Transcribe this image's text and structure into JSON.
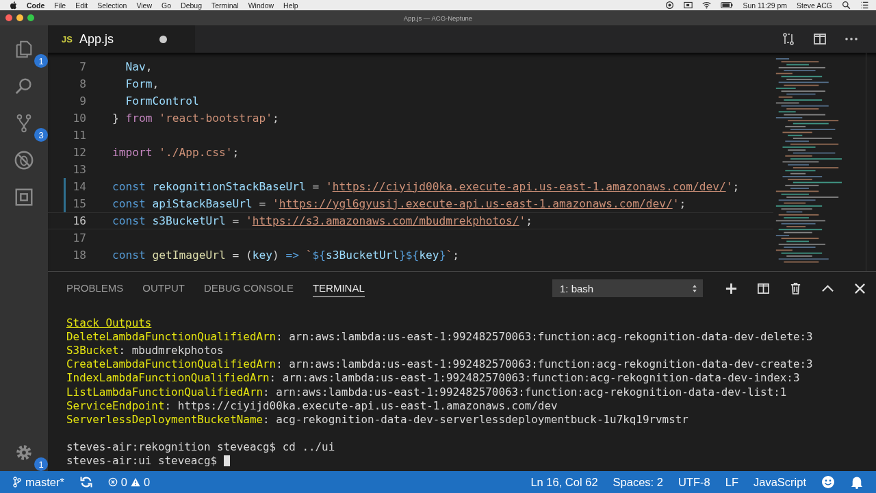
{
  "menu_bar": {
    "app": "Code",
    "items": [
      "File",
      "Edit",
      "Selection",
      "View",
      "Go",
      "Debug",
      "Terminal",
      "Window",
      "Help"
    ],
    "clock": "Sun 11:29 pm",
    "user": "Steve ACG"
  },
  "window": {
    "title": "App.js — ACG-Neptune"
  },
  "activity_bar": {
    "explorer_badge": "1",
    "git_badge": "3",
    "settings_badge": "1"
  },
  "tab": {
    "icon_text": "JS",
    "label": "App.js",
    "dirty": true
  },
  "editor": {
    "lines": [
      {
        "number": "7",
        "current": false,
        "modified": false,
        "tokens": [
          {
            "text": "  Nav",
            "kind": "var"
          },
          {
            "text": ",",
            "kind": "punct"
          }
        ]
      },
      {
        "number": "8",
        "current": false,
        "modified": false,
        "tokens": [
          {
            "text": "  Form",
            "kind": "var"
          },
          {
            "text": ",",
            "kind": "punct"
          }
        ]
      },
      {
        "number": "9",
        "current": false,
        "modified": false,
        "tokens": [
          {
            "text": "  FormControl",
            "kind": "var"
          }
        ]
      },
      {
        "number": "10",
        "current": false,
        "modified": false,
        "tokens": [
          {
            "text": "} ",
            "kind": "punct"
          },
          {
            "text": "from",
            "kind": "control"
          },
          {
            "text": " 'react-bootstrap'",
            "kind": "string"
          },
          {
            "text": ";",
            "kind": "punct"
          }
        ]
      },
      {
        "number": "11",
        "current": false,
        "modified": false
      },
      {
        "number": "12",
        "current": false,
        "modified": false,
        "tokens": [
          {
            "text": "import",
            "kind": "control"
          },
          {
            "text": " './App.css'",
            "kind": "string"
          },
          {
            "text": ";",
            "kind": "punct"
          }
        ]
      },
      {
        "number": "13",
        "current": false,
        "modified": false
      },
      {
        "number": "14",
        "current": false,
        "modified": true,
        "tokens": [
          {
            "text": "const",
            "kind": "keyword"
          },
          {
            "text": " rekognitionStackBaseUrl ",
            "kind": "var"
          },
          {
            "text": "= ",
            "kind": "punct"
          },
          {
            "text": "'",
            "kind": "string"
          },
          {
            "text": "https://ciyijd00ka.execute-api.us-east-1.amazonaws.com/dev/",
            "kind": "link"
          },
          {
            "text": "'",
            "kind": "string"
          },
          {
            "text": ";",
            "kind": "punct"
          }
        ]
      },
      {
        "number": "15",
        "current": false,
        "modified": true,
        "tokens": [
          {
            "text": "const",
            "kind": "keyword"
          },
          {
            "text": " apiStackBaseUrl ",
            "kind": "var"
          },
          {
            "text": "= ",
            "kind": "punct"
          },
          {
            "text": "'",
            "kind": "string"
          },
          {
            "text": "https://ygl6gyusij.execute-api.us-east-1.amazonaws.com/dev/",
            "kind": "link"
          },
          {
            "text": "'",
            "kind": "string"
          },
          {
            "text": ";",
            "kind": "punct"
          }
        ]
      },
      {
        "number": "16",
        "current": true,
        "modified": false,
        "tokens": [
          {
            "text": "const",
            "kind": "keyword"
          },
          {
            "text": " s3BucketUrl ",
            "kind": "var"
          },
          {
            "text": "= ",
            "kind": "punct"
          },
          {
            "text": "'",
            "kind": "string"
          },
          {
            "text": "https://s3.amazonaws.com/mbudmrekphotos/",
            "kind": "link"
          },
          {
            "text": "'",
            "kind": "string"
          },
          {
            "text": ";",
            "kind": "punct"
          }
        ]
      },
      {
        "number": "17",
        "current": false,
        "modified": false
      },
      {
        "number": "18",
        "current": false,
        "modified": false,
        "tokens": [
          {
            "text": "const",
            "kind": "keyword"
          },
          {
            "text": " getImageUrl",
            "kind": "func"
          },
          {
            "text": " = (",
            "kind": "punct"
          },
          {
            "text": "key",
            "kind": "var"
          },
          {
            "text": ") ",
            "kind": "punct"
          },
          {
            "text": "=>",
            "kind": "keyword"
          },
          {
            "text": " `",
            "kind": "string"
          },
          {
            "text": "${",
            "kind": "keyword"
          },
          {
            "text": "s3BucketUrl",
            "kind": "var"
          },
          {
            "text": "}${",
            "kind": "keyword"
          },
          {
            "text": "key",
            "kind": "var"
          },
          {
            "text": "}",
            "kind": "keyword"
          },
          {
            "text": "`",
            "kind": "string"
          },
          {
            "text": ";",
            "kind": "punct"
          }
        ]
      }
    ]
  },
  "panel": {
    "tabs": [
      {
        "label": "PROBLEMS",
        "selected": false
      },
      {
        "label": "OUTPUT",
        "selected": false
      },
      {
        "label": "DEBUG CONSOLE",
        "selected": false
      },
      {
        "label": "TERMINAL",
        "selected": true
      }
    ],
    "terminal_select": "1: bash",
    "terminal_output": [
      [
        {
          "text": "Stack Outputs",
          "kind": "heading"
        }
      ],
      [
        {
          "text": "DeleteLambdaFunctionQualifiedArn",
          "kind": "key"
        },
        {
          "text": ": arn:aws:lambda:us-east-1:992482570063:function:acg-rekognition-data-dev-delete:3",
          "kind": "plain"
        }
      ],
      [
        {
          "text": "S3Bucket",
          "kind": "key"
        },
        {
          "text": ": mbudmrekphotos",
          "kind": "plain"
        }
      ],
      [
        {
          "text": "CreateLambdaFunctionQualifiedArn",
          "kind": "key"
        },
        {
          "text": ": arn:aws:lambda:us-east-1:992482570063:function:acg-rekognition-data-dev-create:3",
          "kind": "plain"
        }
      ],
      [
        {
          "text": "IndexLambdaFunctionQualifiedArn",
          "kind": "key"
        },
        {
          "text": ": arn:aws:lambda:us-east-1:992482570063:function:acg-rekognition-data-dev-index:3",
          "kind": "plain"
        }
      ],
      [
        {
          "text": "ListLambdaFunctionQualifiedArn",
          "kind": "key"
        },
        {
          "text": ": arn:aws:lambda:us-east-1:992482570063:function:acg-rekognition-data-dev-list:1",
          "kind": "plain"
        }
      ],
      [
        {
          "text": "ServiceEndpoint",
          "kind": "key"
        },
        {
          "text": ": https://ciyijd00ka.execute-api.us-east-1.amazonaws.com/dev",
          "kind": "plain"
        }
      ],
      [
        {
          "text": "ServerlessDeploymentBucketName",
          "kind": "key"
        },
        {
          "text": ": acg-rekognition-data-dev-serverlessdeploymentbuck-1u7kq19rvmstr",
          "kind": "plain"
        }
      ]
    ],
    "terminal_commands": [
      "steves-air:rekognition steveacg$ cd ../ui",
      "steves-air:ui steveacg$ "
    ]
  },
  "status_bar": {
    "branch": "master*",
    "errors": "0",
    "warnings": "0",
    "position": "Ln 16, Col 62",
    "indent": "Spaces: 2",
    "encoding": "UTF-8",
    "eol": "LF",
    "language": "JavaScript"
  }
}
